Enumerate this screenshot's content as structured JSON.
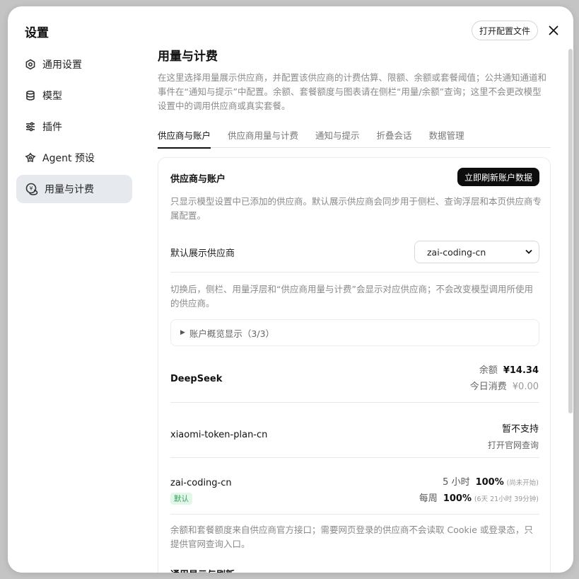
{
  "sidebar": {
    "title": "设置",
    "items": [
      {
        "label": "通用设置",
        "icon": "gear-icon"
      },
      {
        "label": "模型",
        "icon": "database-icon"
      },
      {
        "label": "插件",
        "icon": "sliders-icon"
      },
      {
        "label": "Agent 预设",
        "icon": "agent-icon"
      },
      {
        "label": "用量与计费",
        "icon": "coins-icon",
        "active": true
      }
    ]
  },
  "header": {
    "open_config_label": "打开配置文件"
  },
  "main": {
    "title": "用量与计费",
    "description": "在这里选择用量展示供应商，并配置该供应商的计费估算、限额、余额或套餐阈值；公共通知通道和事件在“通知与提示”中配置。余额、套餐额度与图表请在侧栏“用量/余额”查询；这里不会更改模型设置中的调用供应商或真实套餐。",
    "tabs": [
      {
        "label": "供应商与账户",
        "active": true
      },
      {
        "label": "供应商用量与计费"
      },
      {
        "label": "通知与提示"
      },
      {
        "label": "折叠会话"
      },
      {
        "label": "数据管理"
      }
    ]
  },
  "card": {
    "title": "供应商与账户",
    "refresh_label": "立即刷新账户数据",
    "description": "只显示模型设置中已添加的供应商。默认展示供应商会同步用于侧栏、查询浮层和本页供应商专属配置。",
    "default_provider_label": "默认展示供应商",
    "default_provider_value": "zai-coding-cn",
    "switch_note": "切换后，侧栏、用量浮层和“供应商用量与计费”会显示对应供应商；不会改变模型调用所使用的供应商。",
    "overview_label": "账户概览显示（3/3）",
    "providers": {
      "deepseek": {
        "name": "DeepSeek",
        "balance_label": "余额",
        "balance_value": "¥14.34",
        "today_label": "今日消费",
        "today_value": "¥0.00"
      },
      "xiaomi": {
        "name": "xiaomi-token-plan-cn",
        "status": "暂不支持",
        "link": "打开官网查询"
      },
      "zai": {
        "name": "zai-coding-cn",
        "badge": "默认",
        "q1_label": "5 小时",
        "q1_value": "100%",
        "q1_hint": "(尚未开始)",
        "q2_label": "每周",
        "q2_value": "100%",
        "q2_hint": "(6天 21小时 39分钟)"
      }
    },
    "footer_note": "余额和套餐额度来自供应商官方接口；需要网页登录的供应商不会读取 Cookie 或登录态，只提供官网查询入口。",
    "next_section_title": "通用显示与刷新"
  }
}
